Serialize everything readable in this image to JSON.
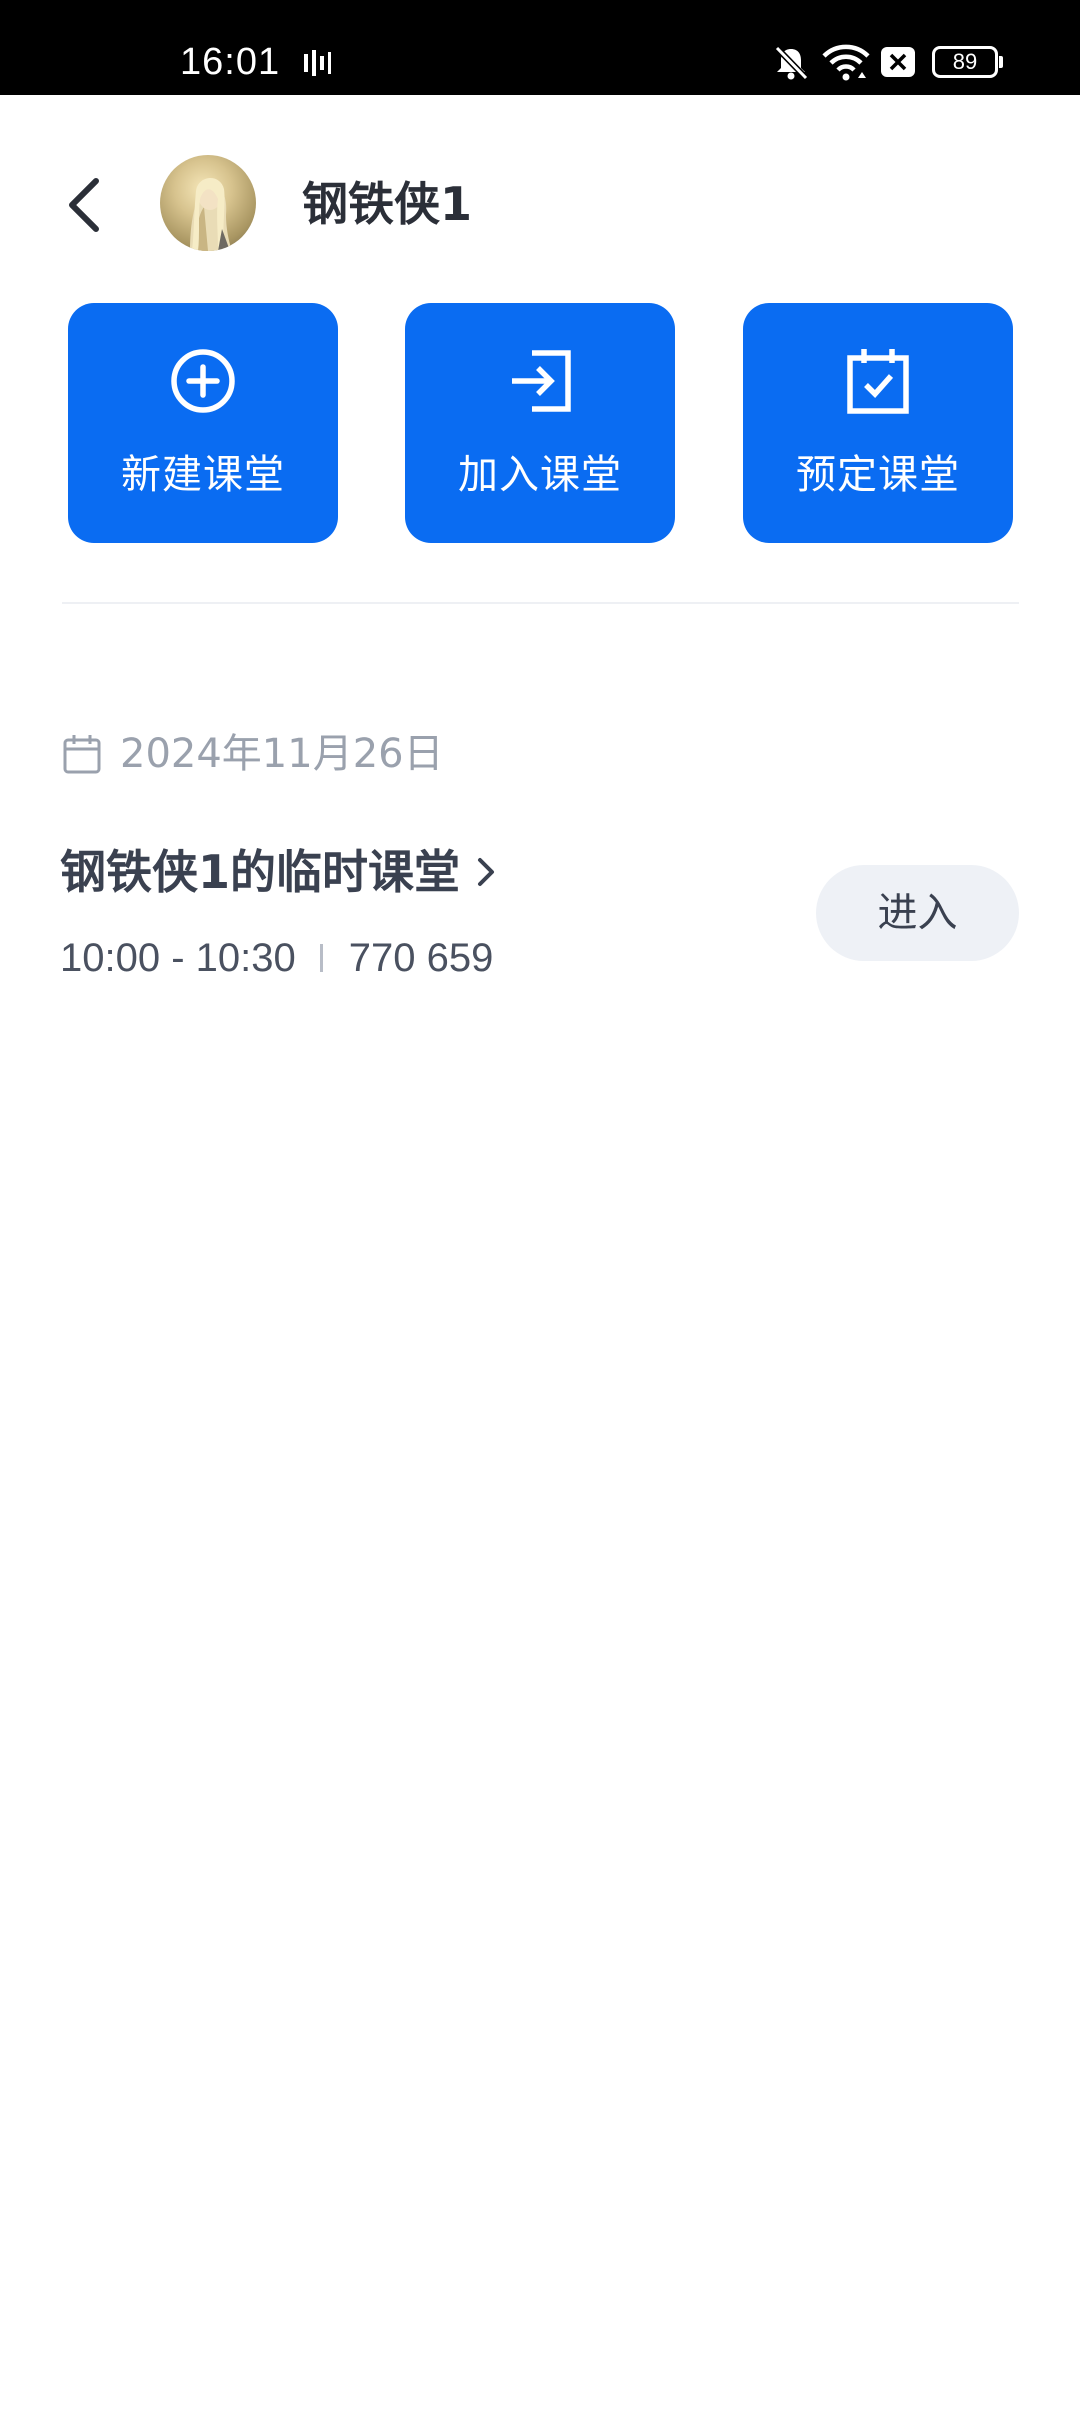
{
  "status_bar": {
    "time": "16:01",
    "battery": "89",
    "icons": [
      "signal-bars-icon",
      "mute-bell-icon",
      "wifi-icon",
      "sim-off-icon",
      "battery-icon"
    ]
  },
  "header": {
    "user_name": "钢铁侠1",
    "back_icon": "chevron-left-icon"
  },
  "actions": [
    {
      "label": "新建课堂",
      "icon": "plus-circle-icon"
    },
    {
      "label": "加入课堂",
      "icon": "login-arrow-icon"
    },
    {
      "label": "预定课堂",
      "icon": "calendar-check-icon"
    }
  ],
  "schedule": {
    "date": "2024年11月26日",
    "meetings": [
      {
        "title": "钢铁侠1的临时课堂",
        "time": "10:00 - 10:30",
        "room_id": "770 659",
        "enter_label": "进入"
      }
    ]
  },
  "colors": {
    "primary": "#0a6cf2",
    "enter_button_bg": "#eef1f6",
    "muted_text": "#9aa1ad"
  }
}
